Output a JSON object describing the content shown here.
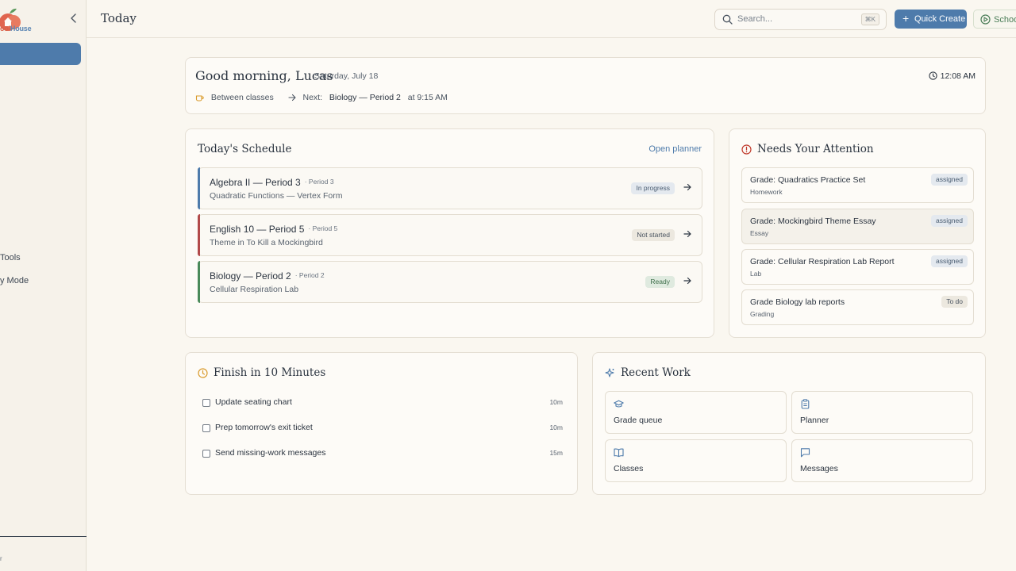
{
  "sidebar": {
    "logo_text_a": "ool",
    "logo_text_b": "House",
    "items": [
      {
        "label": "Tools"
      },
      {
        "label": "y Mode"
      }
    ],
    "footer_mark": "r"
  },
  "header": {
    "title": "Today",
    "search_placeholder": "Search...",
    "search_shortcut": "⌘K",
    "quick_create_label": "Quick Create",
    "school_label": "School"
  },
  "greeting": {
    "text": "Good morning, Lucas",
    "date": "Saturday, July 18",
    "time": "12:08 AM",
    "status": "Between classes",
    "next_label": "Next:",
    "next_class": "Biology — Period 2",
    "next_time": "at 9:15 AM"
  },
  "schedule": {
    "title": "Today's Schedule",
    "open_planner": "Open planner",
    "items": [
      {
        "title": "Algebra II — Period 3",
        "period": "· Period 3",
        "subtitle": "Quadratic Functions — Vertex Form",
        "status": "In progress",
        "color": "#4e7bab"
      },
      {
        "title": "English 10 — Period 5",
        "period": "· Period 5",
        "subtitle": "Theme in To Kill a Mockingbird",
        "status": "Not started",
        "color": "#b24a4a"
      },
      {
        "title": "Biology — Period 2",
        "period": "· Period 2",
        "subtitle": "Cellular Respiration Lab",
        "status": "Ready",
        "color": "#4a8a5a"
      }
    ]
  },
  "attention": {
    "title": "Needs Your Attention",
    "items": [
      {
        "title": "Grade: Quadratics Practice Set",
        "subtitle": "Homework",
        "badge": "assigned"
      },
      {
        "title": "Grade: Mockingbird Theme Essay",
        "subtitle": "Essay",
        "badge": "assigned"
      },
      {
        "title": "Grade: Cellular Respiration Lab Report",
        "subtitle": "Lab",
        "badge": "assigned"
      },
      {
        "title": "Grade Biology lab reports",
        "subtitle": "Grading",
        "badge": "To do"
      }
    ]
  },
  "finish": {
    "title": "Finish in 10 Minutes",
    "tasks": [
      {
        "label": "Update seating chart",
        "duration": "10m"
      },
      {
        "label": "Prep tomorrow's exit ticket",
        "duration": "10m"
      },
      {
        "label": "Send missing-work messages",
        "duration": "15m"
      }
    ]
  },
  "recent": {
    "title": "Recent Work",
    "tiles": [
      {
        "label": "Grade queue",
        "icon": "graduation-cap-icon"
      },
      {
        "label": "Planner",
        "icon": "clipboard-icon"
      },
      {
        "label": "Classes",
        "icon": "book-icon"
      },
      {
        "label": "Messages",
        "icon": "message-icon"
      }
    ]
  },
  "colors": {
    "accent": "#4e7bab",
    "background": "#faf7f0",
    "danger": "#c0392b",
    "warning": "#d99a2b"
  }
}
